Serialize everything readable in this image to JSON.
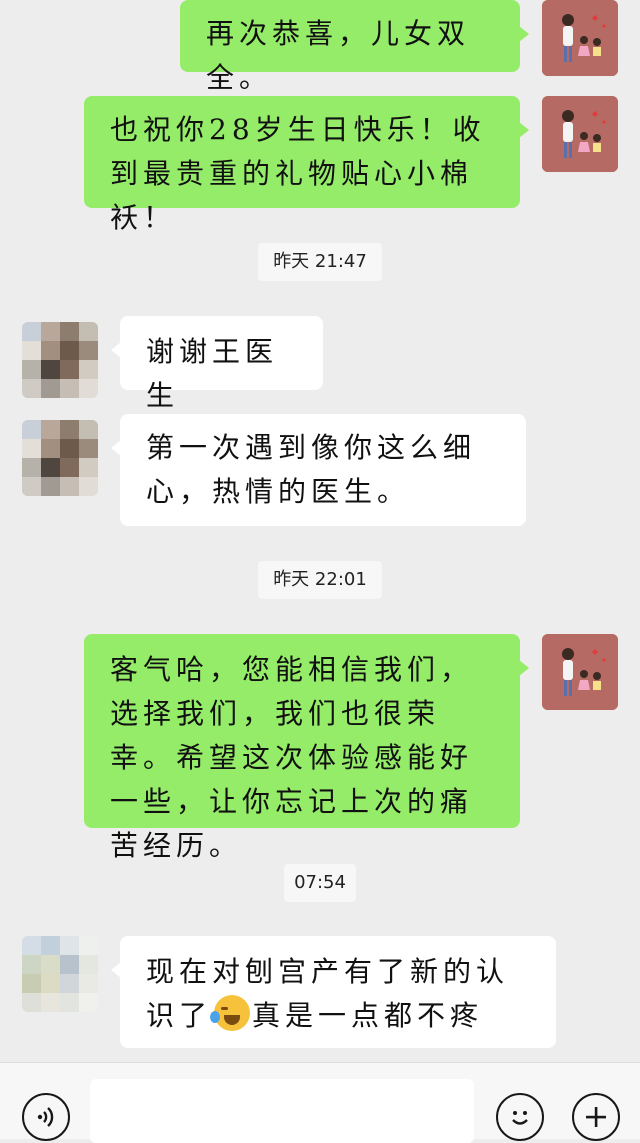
{
  "messages": [
    {
      "type": "me",
      "text": "再次恭喜，儿女双全。"
    },
    {
      "type": "me",
      "text": "也祝你28岁生日快乐！收到最贵重的礼物贴心小棉袄！"
    },
    {
      "type": "timestamp",
      "text": "昨天 21:47"
    },
    {
      "type": "them",
      "text": "谢谢王医生"
    },
    {
      "type": "them",
      "text": "第一次遇到像你这么细心，热情的医生。"
    },
    {
      "type": "timestamp",
      "text": "昨天 22:01"
    },
    {
      "type": "me",
      "text": "客气哈，您能相信我们，选择我们，我们也很荣幸。希望这次体验感能好一些，让你忘记上次的痛苦经历。"
    },
    {
      "type": "timestamp",
      "text": "07:54"
    },
    {
      "type": "them",
      "text_before": "现在对刨宫产有了新的认识了",
      "emoji": "crying-laughing-emoji",
      "text_after": "真是一点都不疼"
    }
  ],
  "bottom_bar": {
    "voice_icon": "voice-icon",
    "input_value": "",
    "emoji_icon": "emoji-icon",
    "plus_icon": "plus-icon"
  },
  "colors": {
    "background": "#ededed",
    "my_bubble": "#95ec69",
    "their_bubble": "#ffffff"
  }
}
